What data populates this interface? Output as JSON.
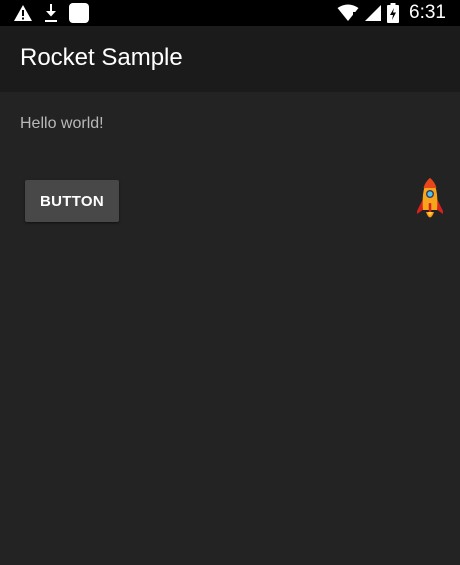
{
  "status_bar": {
    "icons": [
      "warning-icon",
      "download-icon",
      "notification-square-icon"
    ],
    "right_icons": [
      "wifi-icon",
      "cell-signal-icon",
      "battery-charging-icon"
    ],
    "time": "6:31"
  },
  "app_bar": {
    "title": "Rocket Sample"
  },
  "content": {
    "greeting": "Hello world!",
    "button_label": "BUTTON",
    "rocket_icon": "rocket-icon"
  },
  "colors": {
    "status_bar_bg": "#000000",
    "app_bar_bg": "#1b1b1b",
    "content_bg": "#232323",
    "button_bg": "#484848",
    "text_primary": "#ffffff",
    "text_secondary": "#b8b8b8"
  }
}
